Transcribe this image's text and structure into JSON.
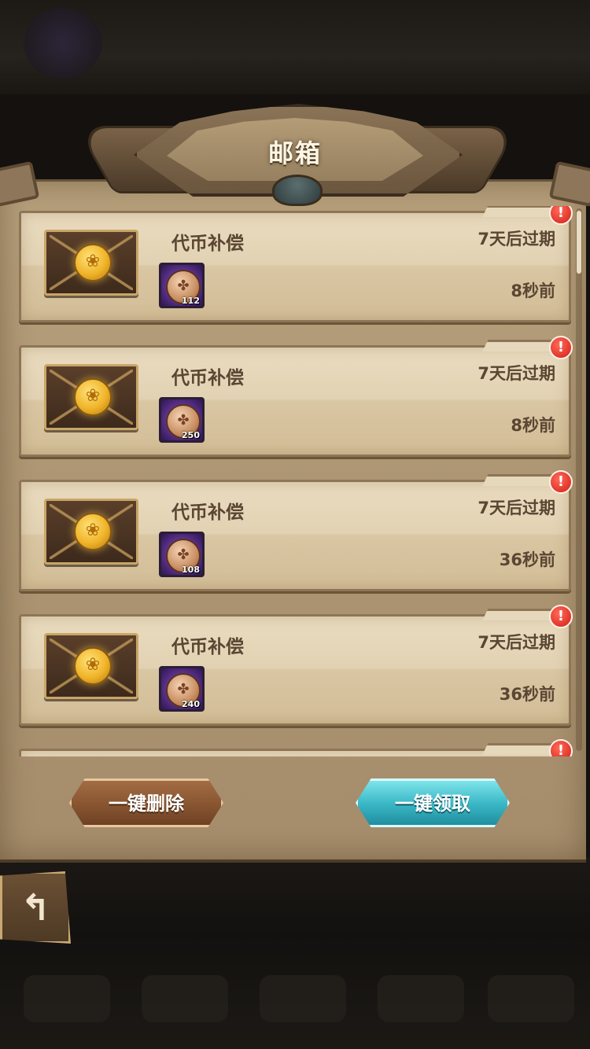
{
  "header": {
    "title": "邮箱"
  },
  "mails": [
    {
      "title": "代币补偿",
      "expire": "7天后过期",
      "time": "8秒前",
      "item_count": "112",
      "unread": true,
      "alert": "!"
    },
    {
      "title": "代币补偿",
      "expire": "7天后过期",
      "time": "8秒前",
      "item_count": "250",
      "unread": true,
      "alert": "!"
    },
    {
      "title": "代币补偿",
      "expire": "7天后过期",
      "time": "36秒前",
      "item_count": "108",
      "unread": true,
      "alert": "!"
    },
    {
      "title": "代币补偿",
      "expire": "7天后过期",
      "time": "36秒前",
      "item_count": "240",
      "unread": true,
      "alert": "!"
    },
    {
      "title": "",
      "expire": "",
      "time": "",
      "item_count": "",
      "unread": true,
      "alert": "!"
    }
  ],
  "buttons": {
    "delete_all": "一键删除",
    "claim_all": "一键领取"
  },
  "icons": {
    "back": "back-arrow-icon",
    "seal_glyph": "❀",
    "coin_glyph": "✤",
    "back_glyph": "↰"
  },
  "colors": {
    "panel": "#b09a77",
    "card": "#e2d2b3",
    "text": "#5a4633",
    "alert": "#d21f14",
    "claim_button": "#3cb9c8",
    "delete_button": "#8a5732"
  }
}
